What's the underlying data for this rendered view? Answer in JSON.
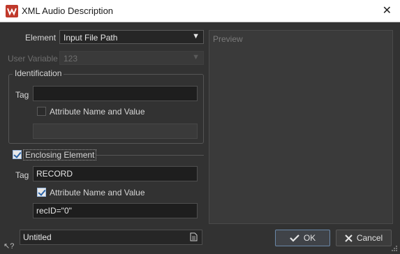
{
  "window": {
    "title": "XML Audio Description"
  },
  "element": {
    "label": "Element",
    "value": "Input File Path"
  },
  "user_variable": {
    "label": "User Variable",
    "value": "123"
  },
  "identification": {
    "title": "Identification",
    "tag_label": "Tag",
    "tag_value": "",
    "attribute_label": "Attribute Name and Value",
    "attribute_checked": false,
    "attribute_value": ""
  },
  "enclosing": {
    "label": "Enclosing Element",
    "checked": true,
    "tag_label": "Tag",
    "tag_value": "RECORD",
    "attribute_label": "Attribute Name and Value",
    "attribute_checked": true,
    "attribute_value": "recID=\"0\""
  },
  "preview": {
    "label": "Preview"
  },
  "preset": {
    "value": "Untitled"
  },
  "buttons": {
    "ok": "OK",
    "cancel": "Cancel"
  },
  "icons": {
    "app": "wavelab-logo-icon",
    "close": "close-icon",
    "ok": "checkmark-icon",
    "cancel": "x-icon",
    "preset": "document-icon",
    "help": "help-icon",
    "grip": "resize-grip-icon"
  },
  "colors": {
    "logo": "#c0392b",
    "background": "#323232",
    "ok_accent": "#6a87a8"
  }
}
